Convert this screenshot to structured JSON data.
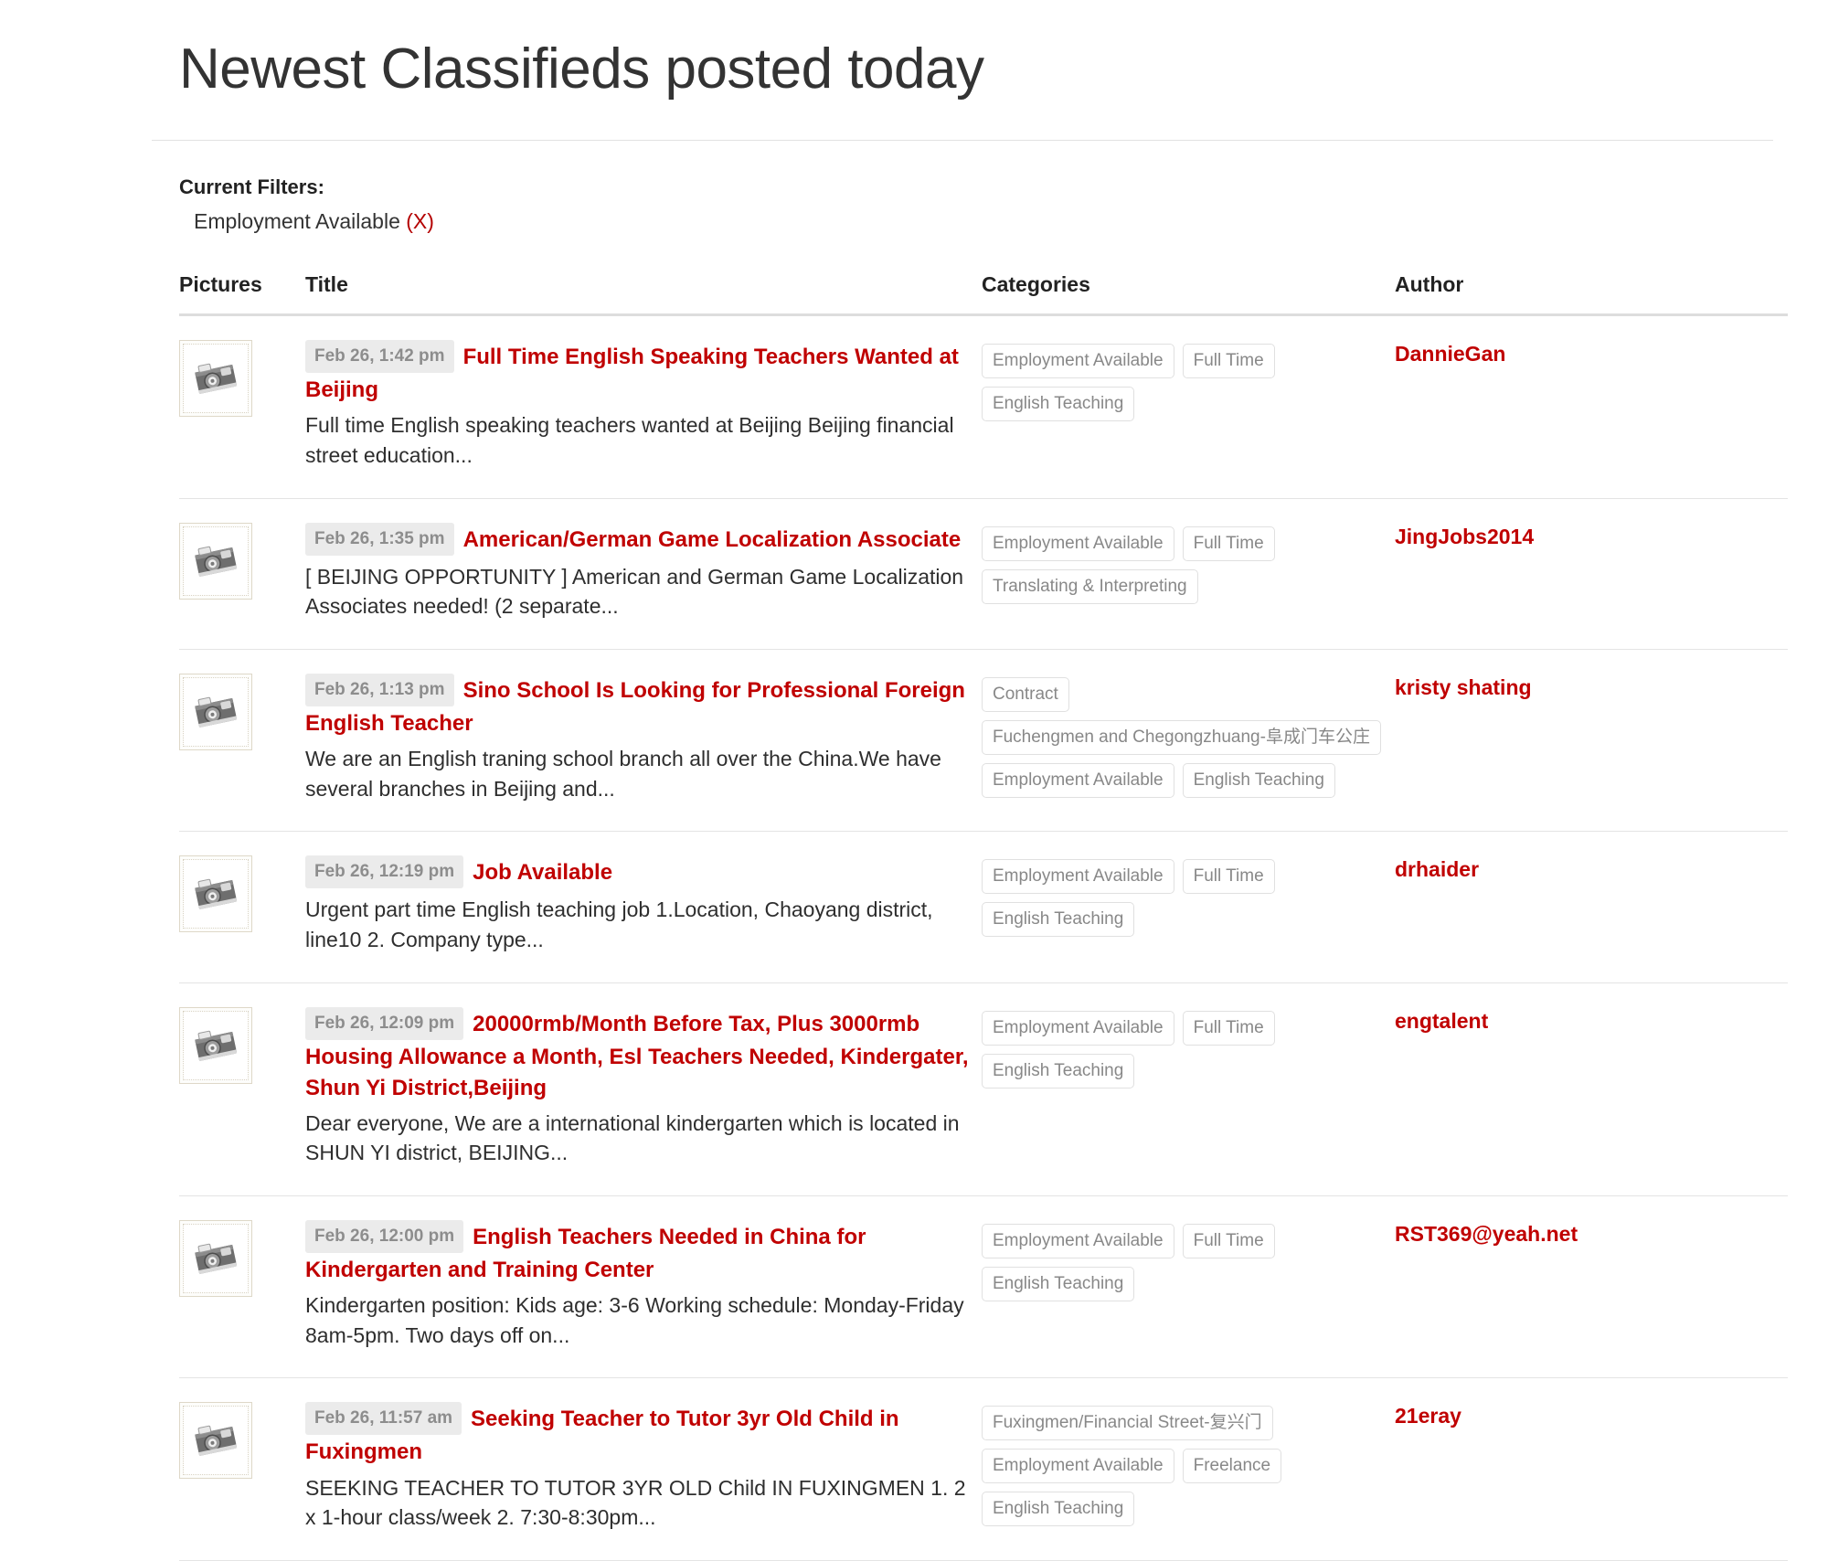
{
  "header": {
    "title": "Newest Classifieds posted today"
  },
  "filters": {
    "label": "Current Filters:",
    "items": [
      {
        "name": "Employment Available",
        "remove_label": "(X)"
      }
    ]
  },
  "table": {
    "columns": {
      "pictures": "Pictures",
      "title": "Title",
      "categories": "Categories",
      "author": "Author"
    },
    "rows": [
      {
        "thumb_icon": "camera-placeholder-icon",
        "time": "Feb 26, 1:42 pm",
        "title": "Full Time English Speaking Teachers Wanted at Beijing",
        "excerpt": "Full time English speaking teachers wanted at Beijing Beijing financial street education...",
        "categories": [
          "Employment Available",
          "Full Time",
          "English Teaching"
        ],
        "author": "DannieGan"
      },
      {
        "thumb_icon": "camera-placeholder-icon",
        "time": "Feb 26, 1:35 pm",
        "title": "American/German Game Localization Associate",
        "excerpt": "[ BEIJING OPPORTUNITY ] American and German Game Localization Associates needed! (2 separate...",
        "categories": [
          "Employment Available",
          "Full Time",
          "Translating & Interpreting"
        ],
        "author": "JingJobs2014"
      },
      {
        "thumb_icon": "camera-placeholder-icon",
        "time": "Feb 26, 1:13 pm",
        "title": "Sino School Is Looking for Professional Foreign English Teacher",
        "excerpt": "We are an English traning school branch all over the China.We have several branches in Beijing and...",
        "categories": [
          "Contract",
          "Fuchengmen and Chegongzhuang-阜成门车公庄",
          "Employment Available",
          "English Teaching"
        ],
        "author": "kristy shating"
      },
      {
        "thumb_icon": "camera-placeholder-icon",
        "time": "Feb 26, 12:19 pm",
        "title": "Job Available",
        "excerpt": "Urgent part time English teaching job 1.Location, Chaoyang district,  line10 2. Company type...",
        "categories": [
          "Employment Available",
          "Full Time",
          "English Teaching"
        ],
        "author": "drhaider"
      },
      {
        "thumb_icon": "camera-placeholder-icon",
        "time": "Feb 26, 12:09 pm",
        "title": "20000rmb/Month Before Tax, Plus 3000rmb Housing Allowance a Month, Esl Teachers Needed, Kindergater, Shun Yi District,Beijing",
        "excerpt": "Dear everyone, We are a international kindergarten which is located in SHUN YI district, BEIJING...",
        "categories": [
          "Employment Available",
          "Full Time",
          "English Teaching"
        ],
        "author": "engtalent"
      },
      {
        "thumb_icon": "camera-placeholder-icon",
        "time": "Feb 26, 12:00 pm",
        "title": "English Teachers Needed in China for Kindergarten and Training Center",
        "excerpt": "Kindergarten position: Kids age: 3-6 Working schedule: Monday-Friday 8am-5pm. Two days off on...",
        "categories": [
          "Employment Available",
          "Full Time",
          "English Teaching"
        ],
        "author": "RST369@yeah.net"
      },
      {
        "thumb_icon": "camera-placeholder-icon",
        "time": "Feb 26, 11:57 am",
        "title": "Seeking Teacher to Tutor 3yr Old Child in Fuxingmen",
        "excerpt": "SEEKING TEACHER TO TUTOR 3YR OLD Child IN FUXINGMEN 1. 2 x 1-hour class/week 2. 7:30-8:30pm...",
        "categories": [
          "Fuxingmen/Financial Street-复兴门",
          "Employment Available",
          "Freelance",
          "English Teaching"
        ],
        "author": "21eray"
      }
    ]
  },
  "colors": {
    "link_red": "#c00000",
    "filter_remove_red": "#b40000",
    "tag_text": "#888888",
    "time_badge_bg": "#ebebeb"
  }
}
